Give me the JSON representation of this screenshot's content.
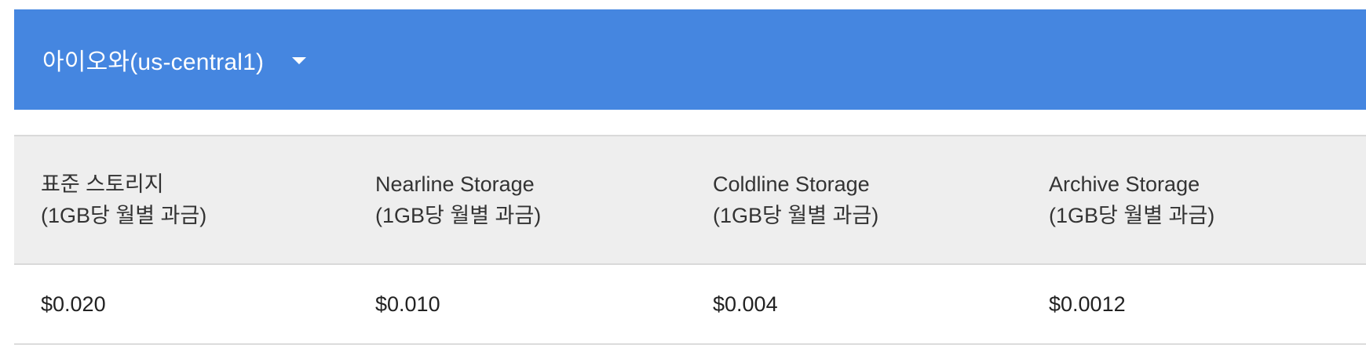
{
  "region": {
    "selected": "아이오와(us-central1)",
    "dropdown_icon": "caret-down-icon",
    "bar_color": "#4586e0"
  },
  "table": {
    "columns": [
      {
        "name": "표준 스토리지",
        "unit": "(1GB당 월별 과금)"
      },
      {
        "name": "Nearline Storage",
        "unit": "(1GB당 월별 과금)"
      },
      {
        "name": "Coldline Storage",
        "unit": "(1GB당 월별 과금)"
      },
      {
        "name": "Archive Storage",
        "unit": "(1GB당 월별 과금)"
      }
    ],
    "rows": [
      [
        "$0.020",
        "$0.010",
        "$0.004",
        "$0.0012"
      ]
    ],
    "header_background": "#eeeeee"
  }
}
